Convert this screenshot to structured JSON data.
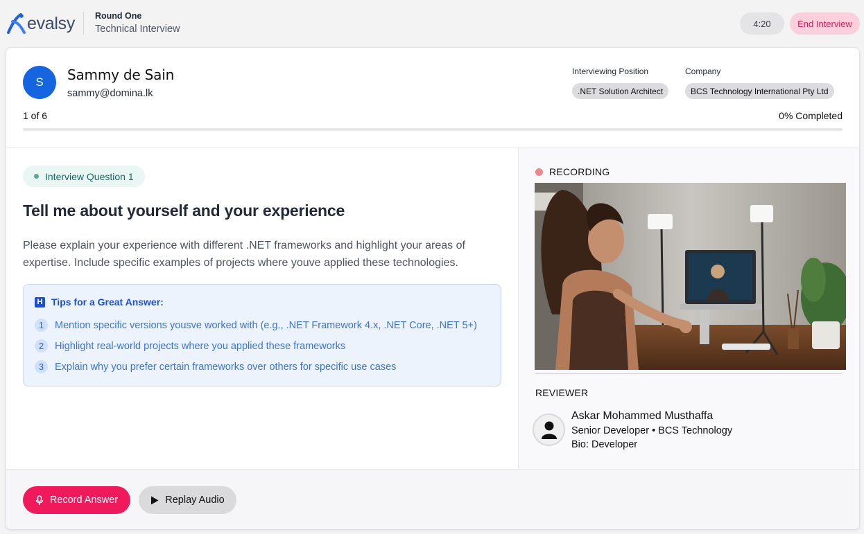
{
  "header": {
    "logo_text": "evalsy",
    "round_title": "Round One",
    "round_subtitle": "Technical Interview",
    "timer": "4:20",
    "end_label": "End Interview"
  },
  "candidate": {
    "initial": "S",
    "name": "Sammy de Sain",
    "email": "sammy@domina.lk"
  },
  "meta": {
    "position_label": "Interviewing Position",
    "position_value": ".NET Solution Architect",
    "company_label": "Company",
    "company_value": "BCS Technology International Pty Ltd"
  },
  "progress": {
    "count": "1 of 6",
    "percent_text": "0% Completed",
    "fraction": 0
  },
  "question": {
    "badge": "Interview Question 1",
    "title": "Tell me about yourself and your experience",
    "description": "Please explain your experience with different .NET frameworks and highlight your areas of expertise. Include specific examples of projects where youve applied these technologies."
  },
  "tips": {
    "heading": "Tips for a Great Answer:",
    "items": [
      {
        "num": "1",
        "text": "Mention specific versions yousve worked with (e.g., .NET Framework 4.x, .NET Core, .NET 5+)"
      },
      {
        "num": "2",
        "text": "Highlight real-world projects where you applied these frameworks"
      },
      {
        "num": "3",
        "text": "Explain why you prefer certain frameworks over others for specific use cases"
      }
    ]
  },
  "recording": {
    "label": "RECORDING",
    "status_color": "#ea8a8f"
  },
  "reviewer": {
    "section_label": "REVIEWER",
    "name": "Askar Mohammed Musthaffa",
    "role": "Senior Developer • BCS Technology",
    "bio": "Bio: Developer"
  },
  "actions": {
    "record_label": "Record Answer",
    "replay_label": "Replay Audio"
  },
  "colors": {
    "brand_blue": "#1565e0",
    "record_pink": "#ee1a5c",
    "end_pink_bg": "#fbcfdc",
    "tips_blue": "#1d4ed8"
  },
  "icons": {
    "logo": "evalsy-logo-icon",
    "tips": "tips-icon",
    "record": "microphone-icon",
    "replay": "play-icon",
    "reviewer_avatar": "person-icon"
  }
}
